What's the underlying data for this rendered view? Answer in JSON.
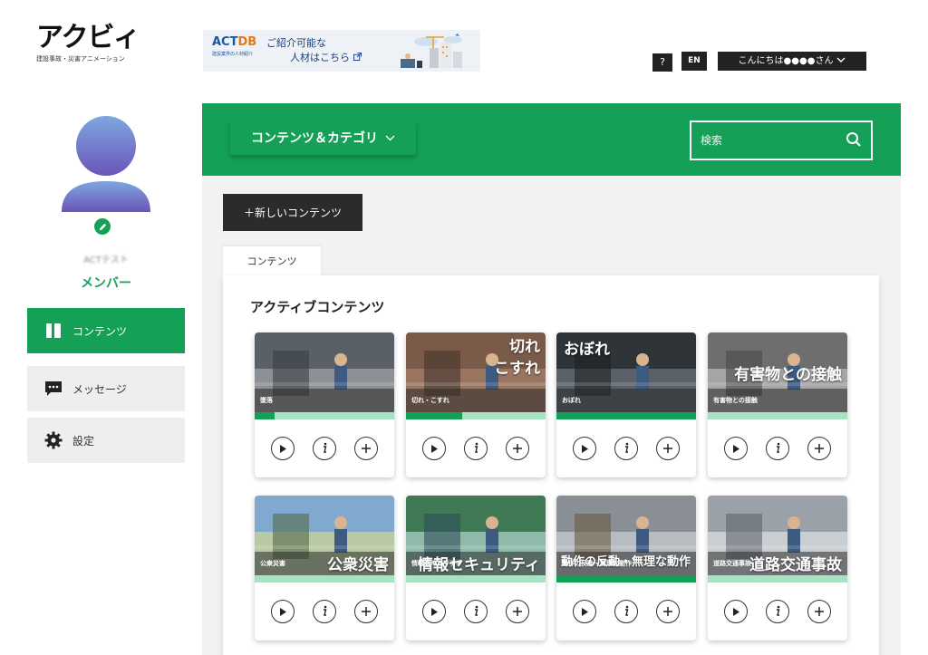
{
  "logo": {
    "main": "アクビィ",
    "sub": "建設事故・災害アニメーション"
  },
  "banner": {
    "brand_act": "ACT",
    "brand_db": "DB",
    "tagline": "建設業界の人材紹介",
    "line1": "ご紹介可能な",
    "line2": "人材はこちら",
    "ext_icon": "external-link-icon"
  },
  "header": {
    "help_label": "?",
    "lang_label": "EN",
    "greeting": "こんにちは●●●●さん"
  },
  "sidebar": {
    "user_name": "ACTテスト",
    "role": "メンバー",
    "items": [
      {
        "label": "コンテンツ",
        "icon": "book-icon",
        "active": true
      },
      {
        "label": "メッセージ",
        "icon": "chat-icon",
        "active": false
      },
      {
        "label": "設定",
        "icon": "gear-icon",
        "active": false
      }
    ]
  },
  "main": {
    "category_button": "コンテンツ＆カテゴリ",
    "search_placeholder": "検索",
    "new_button": "＋新しいコンテンツ",
    "tab_label": "コンテンツ",
    "section_title": "アクティブコンテンツ"
  },
  "contents": [
    {
      "small": "墜落",
      "big": "",
      "progress": 0.14
    },
    {
      "small": "切れ・こすれ",
      "big": "切れ\nこすれ",
      "progress": 0.4
    },
    {
      "small": "おぼれ",
      "big": "おぼれ",
      "progress": 1.0
    },
    {
      "small": "有害物との接触",
      "big": "有害物との接触",
      "progress": 0.0
    },
    {
      "small": "公衆災害",
      "big": "公衆災害",
      "progress": 0.0
    },
    {
      "small": "情報セキュリティ",
      "big": "情報セキュリティ",
      "progress": 0.0
    },
    {
      "small": "動作の反動・無理な動作",
      "big": "動作の反動・無理な動作",
      "progress": 1.0
    },
    {
      "small": "道路交通事故",
      "big": "道路交通事故",
      "progress": 0.0
    }
  ],
  "colors": {
    "brand_green": "#15a058",
    "progress_light": "#a7e2c2",
    "dark": "#2b2b2b"
  }
}
